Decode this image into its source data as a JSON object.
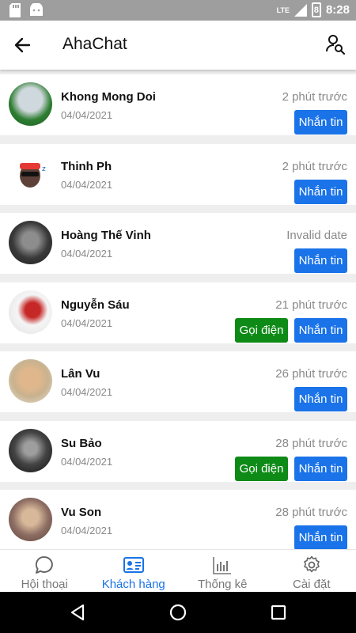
{
  "status_bar": {
    "network": "LTE",
    "battery": "8",
    "time": "8:28"
  },
  "app_bar": {
    "title": "AhaChat"
  },
  "customers": [
    {
      "name": "Khong Mong Doi",
      "date": "04/04/2021",
      "time_ago": "2 phút trước",
      "call_label": null,
      "message_label": "Nhắn tin",
      "avatar_color": "#4caf50"
    },
    {
      "name": "Thinh Ph",
      "date": "04/04/2021",
      "time_ago": "2 phút trước",
      "call_label": null,
      "message_label": "Nhắn tin",
      "avatar_color": "#ffffff"
    },
    {
      "name": "Hoàng Thế Vinh",
      "date": "04/04/2021",
      "time_ago": "Invalid date",
      "call_label": null,
      "message_label": "Nhắn tin",
      "avatar_color": "#3a3a3a"
    },
    {
      "name": "Nguyễn Sáu",
      "date": "04/04/2021",
      "time_ago": "21 phút trước",
      "call_label": "Gọi điện",
      "message_label": "Nhắn tin",
      "avatar_color": "#e6e6e6"
    },
    {
      "name": "Lân Vu",
      "date": "04/04/2021",
      "time_ago": "26 phút trước",
      "call_label": null,
      "message_label": "Nhắn tin",
      "avatar_color": "#d9c9a8"
    },
    {
      "name": "Su Bảo",
      "date": "04/04/2021",
      "time_ago": "28 phút trước",
      "call_label": "Gọi điện",
      "message_label": "Nhắn tin",
      "avatar_color": "#2a2a2a"
    },
    {
      "name": "Vu Son",
      "date": "04/04/2021",
      "time_ago": "28 phút trước",
      "call_label": null,
      "message_label": "Nhắn tin",
      "avatar_color": "#b58d6a"
    }
  ],
  "bottom_nav": [
    {
      "label": "Hội thoại",
      "icon": "chat-bubble-icon",
      "active": false
    },
    {
      "label": "Khách hàng",
      "icon": "contact-card-icon",
      "active": true
    },
    {
      "label": "Thống kê",
      "icon": "bar-chart-icon",
      "active": false
    },
    {
      "label": "Cài đặt",
      "icon": "gear-icon",
      "active": false
    }
  ],
  "colors": {
    "accent": "#1a73e8",
    "call": "#0e8a16",
    "status_bar": "#9e9e9e"
  }
}
